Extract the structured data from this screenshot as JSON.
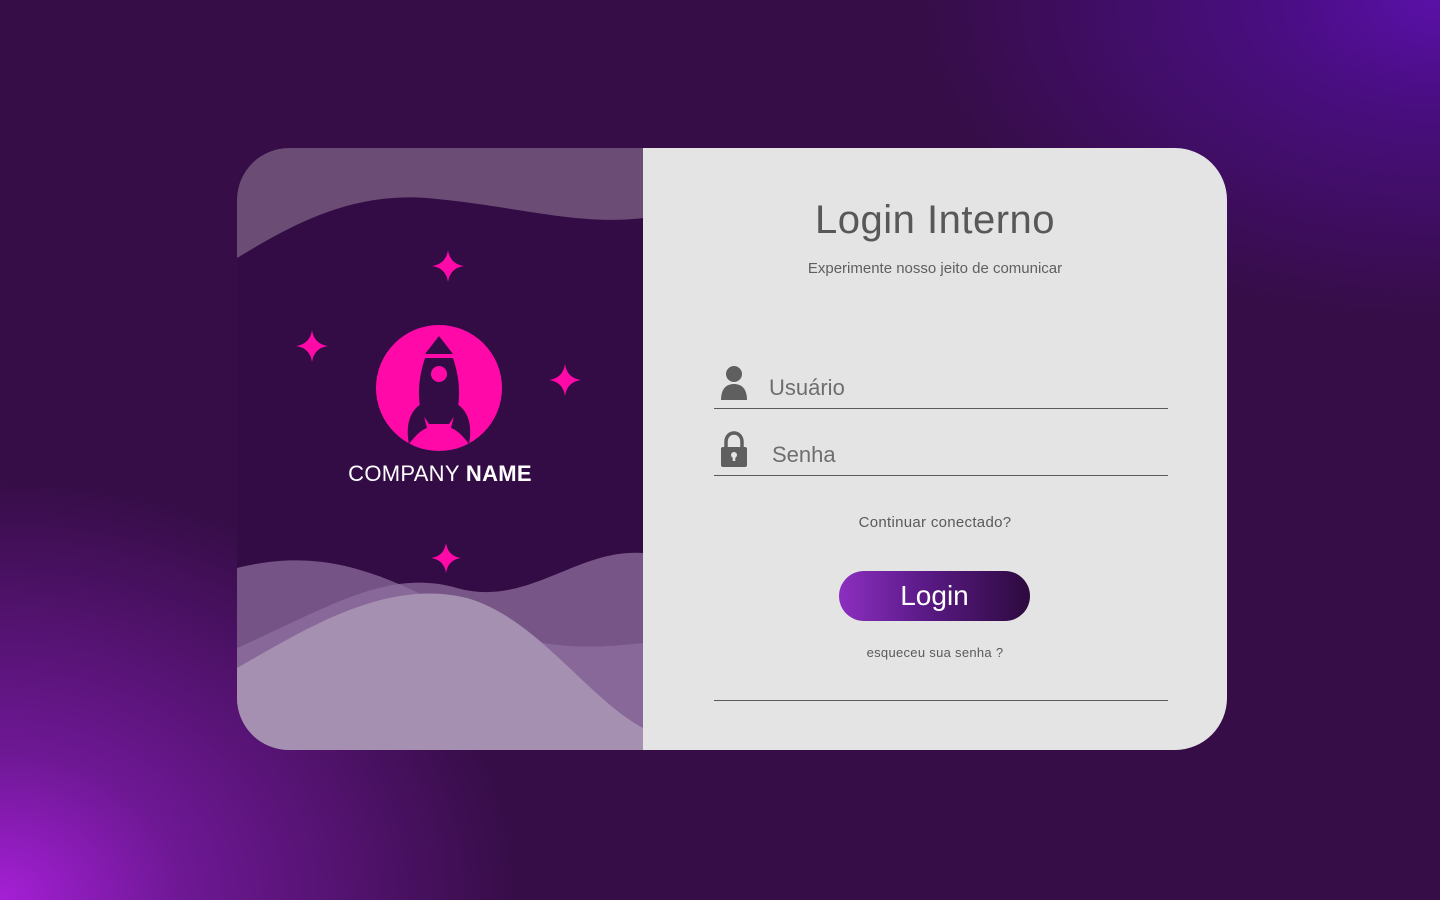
{
  "brand": {
    "company_light": "COMPANY",
    "company_bold": "NAME",
    "logo_icon": "rocket-icon",
    "accent_color": "#ff0aa8"
  },
  "form": {
    "title": "Login Interno",
    "subtitle": "Experimente nosso jeito de comunicar",
    "username": {
      "placeholder": "Usuário",
      "value": "",
      "icon": "user-icon"
    },
    "password": {
      "placeholder": "Senha",
      "value": "",
      "icon": "lock-icon"
    },
    "remember_label": "Continuar conectado?",
    "login_label": "Login",
    "forgot_label": "esqueceu sua senha ?"
  },
  "colors": {
    "background": "#360d47",
    "panel_dark": "#340c45",
    "panel_light": "#e4e4e4",
    "button_start": "#8c2fc0",
    "button_end": "#2d0a3e"
  }
}
